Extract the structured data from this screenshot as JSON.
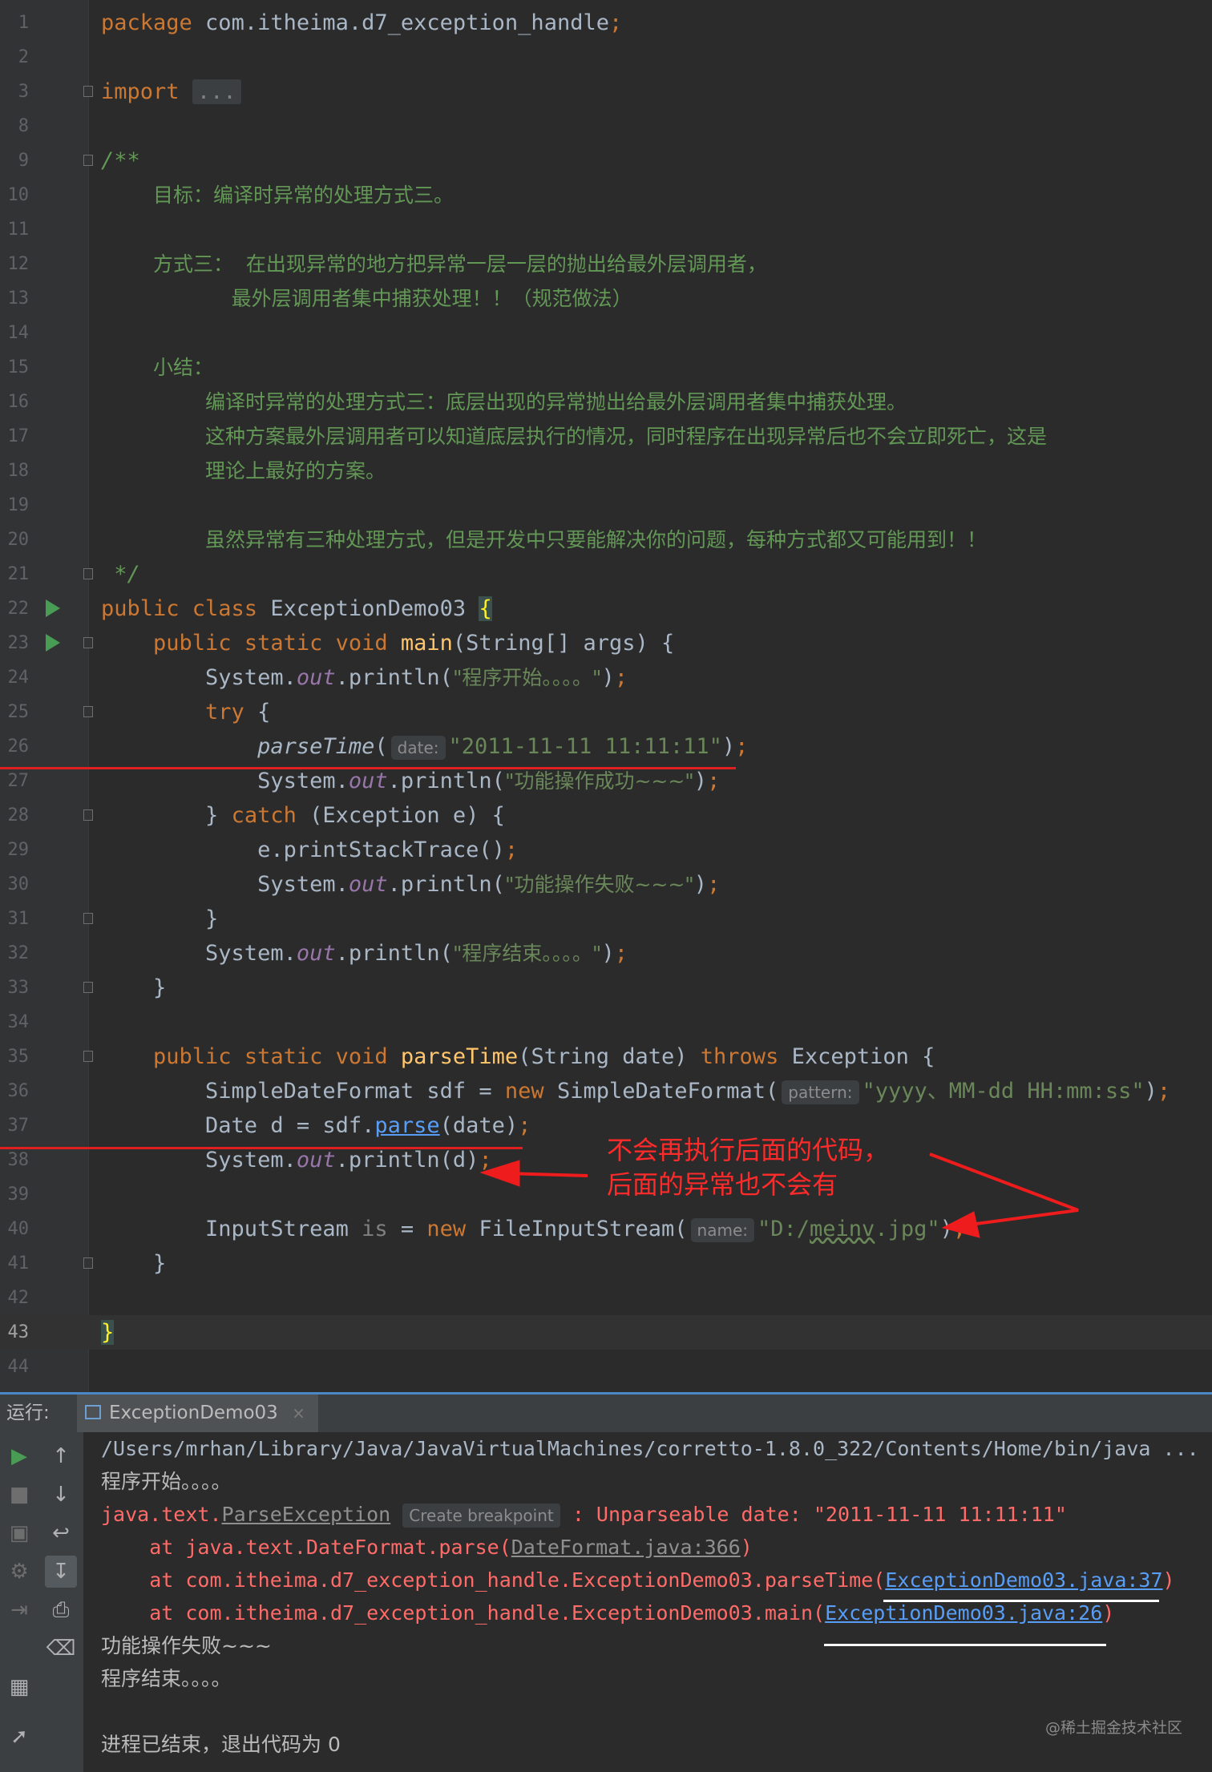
{
  "editor": {
    "lines": [
      {
        "n": "1"
      },
      {
        "n": "2"
      },
      {
        "n": "3"
      },
      {
        "n": "8"
      },
      {
        "n": "9"
      },
      {
        "n": "10"
      },
      {
        "n": "11"
      },
      {
        "n": "12"
      },
      {
        "n": "13"
      },
      {
        "n": "14"
      },
      {
        "n": "15"
      },
      {
        "n": "16"
      },
      {
        "n": "17"
      },
      {
        "n": "18"
      },
      {
        "n": "19"
      },
      {
        "n": "20"
      },
      {
        "n": "21"
      },
      {
        "n": "22"
      },
      {
        "n": "23"
      },
      {
        "n": "24"
      },
      {
        "n": "25"
      },
      {
        "n": "26"
      },
      {
        "n": "27"
      },
      {
        "n": "28"
      },
      {
        "n": "29"
      },
      {
        "n": "30"
      },
      {
        "n": "31"
      },
      {
        "n": "32"
      },
      {
        "n": "33"
      },
      {
        "n": "34"
      },
      {
        "n": "35"
      },
      {
        "n": "36"
      },
      {
        "n": "37"
      },
      {
        "n": "38"
      },
      {
        "n": "39"
      },
      {
        "n": "40"
      },
      {
        "n": "41"
      },
      {
        "n": "42"
      },
      {
        "n": "43"
      },
      {
        "n": "44"
      }
    ],
    "package_kw": "package",
    "package_name": " com.itheima.d7_exception_handle",
    "import_kw": "import",
    "import_folded": "...",
    "doc_open": "/**",
    "doc_goal": "目标：编译时异常的处理方式三。",
    "doc_way3_a": "方式三：  在出现异常的地方把异常一层一层的抛出给最外层调用者，",
    "doc_way3_b": "最外层调用者集中捕获处理！！（规范做法）",
    "doc_summary": "小结：",
    "doc_sum1": "编译时异常的处理方式三：底层出现的异常抛出给最外层调用者集中捕获处理。",
    "doc_sum2": "这种方案最外层调用者可以知道底层执行的情况，同时程序在出现异常后也不会立即死亡，这是",
    "doc_sum3": "理论上最好的方案。",
    "doc_sum4": "虽然异常有三种处理方式，但是开发中只要能解决你的问题，每种方式都又可能用到！！",
    "doc_close": " */",
    "class_name": "ExceptionDemo03",
    "main_name": "main",
    "main_params": "(String[] args) {",
    "msg_start": "\"程序开始。。。。\"",
    "msg_ok": "\"功能操作成功~~~\"",
    "msg_fail": "\"功能操作失败~~~\"",
    "msg_end": "\"程序结束。。。。\"",
    "hint_date": "date:",
    "date_literal": "\"2011-11-11 11:11:11\"",
    "parse_time": "parseTime",
    "parse_params": "(String date)",
    "hint_pattern": "pattern:",
    "pattern_literal": "\"yyyy、MM-dd HH:mm:ss\"",
    "parse_call": "parse",
    "hint_name": "name:",
    "file_literal_a": "\"D:/",
    "file_literal_b": "meinv",
    "file_literal_c": ".jpg\""
  },
  "annotation": {
    "line1": "不会再执行后面的代码，",
    "line2": "后面的异常也不会有",
    "color": "#ff2a2a"
  },
  "run": {
    "label": "运行:",
    "tab": "ExceptionDemo03",
    "tab_close": "×"
  },
  "console": {
    "cmd": "/Users/mrhan/Library/Java/JavaVirtualMachines/corretto-1.8.0_322/Contents/Home/bin/java ...",
    "start": "程序开始。。。。",
    "ex_class_a": "java.text.",
    "ex_class_b": "ParseException",
    "bp_hint": "Create breakpoint",
    "ex_msg": ": Unparseable date: \"2011-11-11 11:11:11\"",
    "at1_a": "    at java.text.DateFormat.parse(",
    "at1_link": "DateFormat.java:366",
    "at1_c": ")",
    "at2_a": "    at com.itheima.d7_exception_handle.ExceptionDemo03.parseTime(",
    "at2_link": "ExceptionDemo03.java:37",
    "at2_c": ")",
    "at3_a": "    at com.itheima.d7_exception_handle.ExceptionDemo03.main(",
    "at3_link": "ExceptionDemo03.java:26",
    "at3_c": ")",
    "fail": "功能操作失败~~~",
    "end": "程序结束。。。。",
    "exit": "进程已结束，退出代码为 0"
  },
  "watermark": "@稀土掘金技术社区"
}
